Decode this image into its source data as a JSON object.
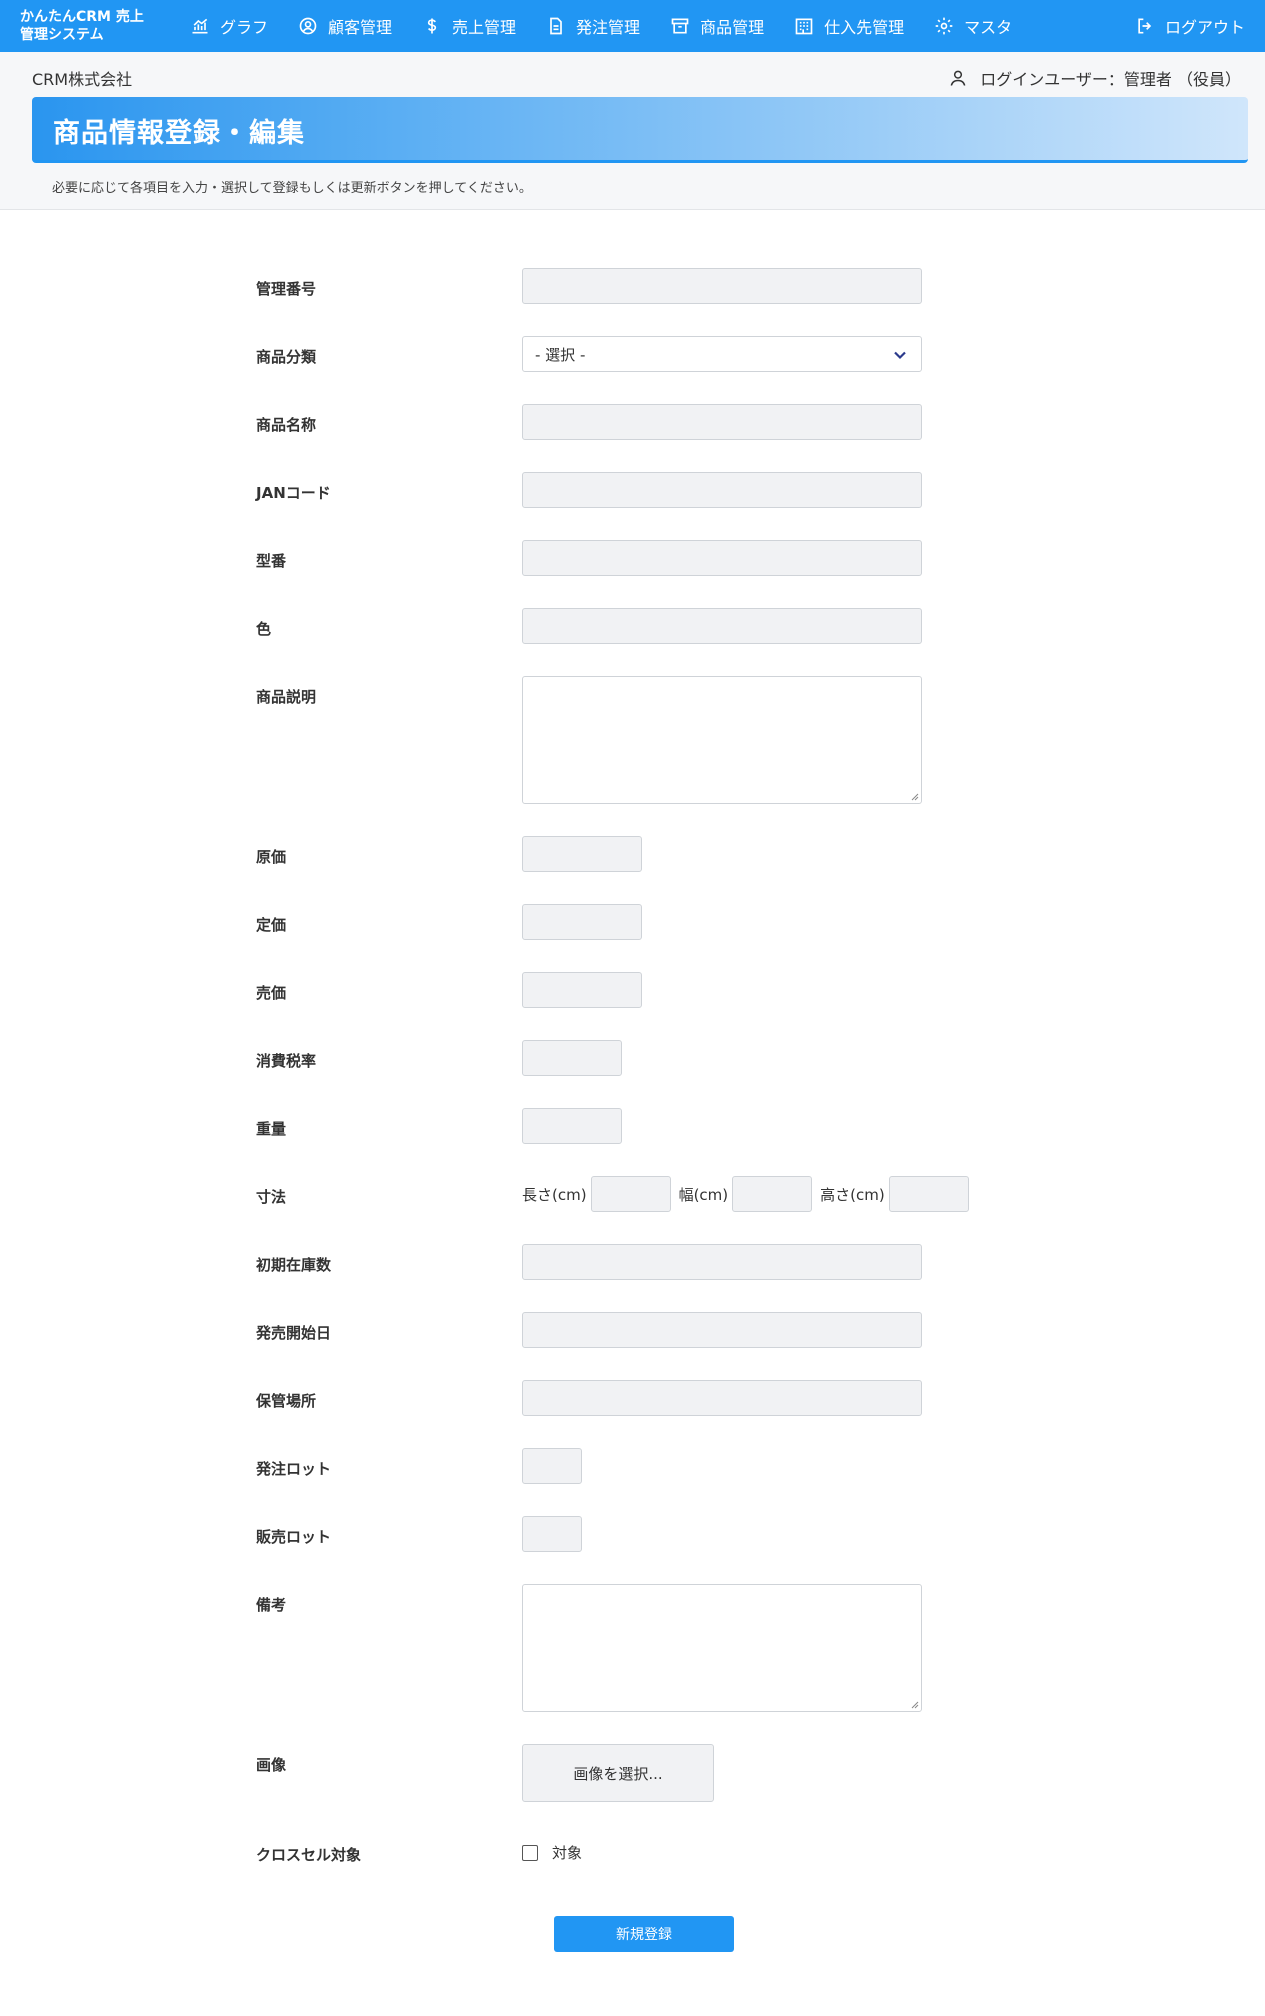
{
  "brand": {
    "line1": "かんたんCRM 売上",
    "line2": "管理システム"
  },
  "nav": {
    "items": [
      {
        "label": "グラフ",
        "icon": "chart-icon"
      },
      {
        "label": "顧客管理",
        "icon": "user-circle-icon"
      },
      {
        "label": "売上管理",
        "icon": "dollar-icon"
      },
      {
        "label": "発注管理",
        "icon": "document-icon"
      },
      {
        "label": "商品管理",
        "icon": "archive-icon"
      },
      {
        "label": "仕入先管理",
        "icon": "building-icon"
      },
      {
        "label": "マスタ",
        "icon": "gear-icon"
      }
    ],
    "logout": "ログアウト"
  },
  "header": {
    "company": "CRM株式会社",
    "login_user": "ログインユーザー：管理者 （役員）",
    "title": "商品情報登録・編集",
    "instruction": "必要に応じて各項目を入力・選択して登録もしくは更新ボタンを押してください。"
  },
  "form": {
    "management_number": "管理番号",
    "category": "商品分類",
    "category_selected": "- 選択 -",
    "product_name": "商品名称",
    "jan_code": "JANコード",
    "model_number": "型番",
    "color": "色",
    "description": "商品説明",
    "cost_price": "原価",
    "list_price": "定価",
    "sale_price": "売価",
    "tax_rate": "消費税率",
    "weight": "重量",
    "dimensions": "寸法",
    "dim_length": "長さ(cm)",
    "dim_width": "幅(cm)",
    "dim_height": "高さ(cm)",
    "initial_stock": "初期在庫数",
    "release_date": "発売開始日",
    "storage_location": "保管場所",
    "order_lot": "発注ロット",
    "sales_lot": "販売ロット",
    "remarks": "備考",
    "image": "画像",
    "image_button": "画像を選択...",
    "cross_sell": "クロスセル対象",
    "cross_sell_option": "対象",
    "submit": "新規登録"
  }
}
